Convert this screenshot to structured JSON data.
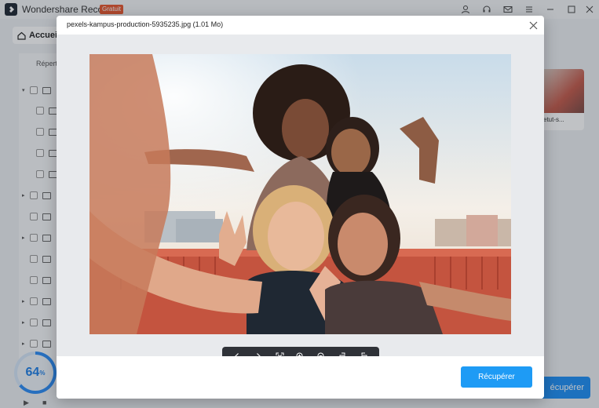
{
  "app": {
    "title": "Wondershare Recoverit",
    "badge": "Gratuit"
  },
  "titlebar_icons": [
    "user-icon",
    "headset-icon",
    "mail-icon",
    "menu-icon",
    "minimize-icon",
    "maximize-icon",
    "close-icon"
  ],
  "background": {
    "home_tab": "Accueil",
    "left_tab": "Répert",
    "thumbnail_label": "etut-s...",
    "recover_label": "écupérer",
    "progress": {
      "value": 64,
      "unit": "%"
    }
  },
  "modal": {
    "title": "pexels-kampus-production-5935235.jpg (1.01 Mo)",
    "toolbar": [
      "prev-icon",
      "next-icon",
      "fit-screen-icon",
      "zoom-in-icon",
      "zoom-out-icon",
      "rotate-left-icon",
      "rotate-right-icon"
    ],
    "recover_button": "Récupérer"
  },
  "colors": {
    "accent": "#1e9bf5",
    "badge": "#e8572e",
    "toolbar": "#2f3238"
  }
}
